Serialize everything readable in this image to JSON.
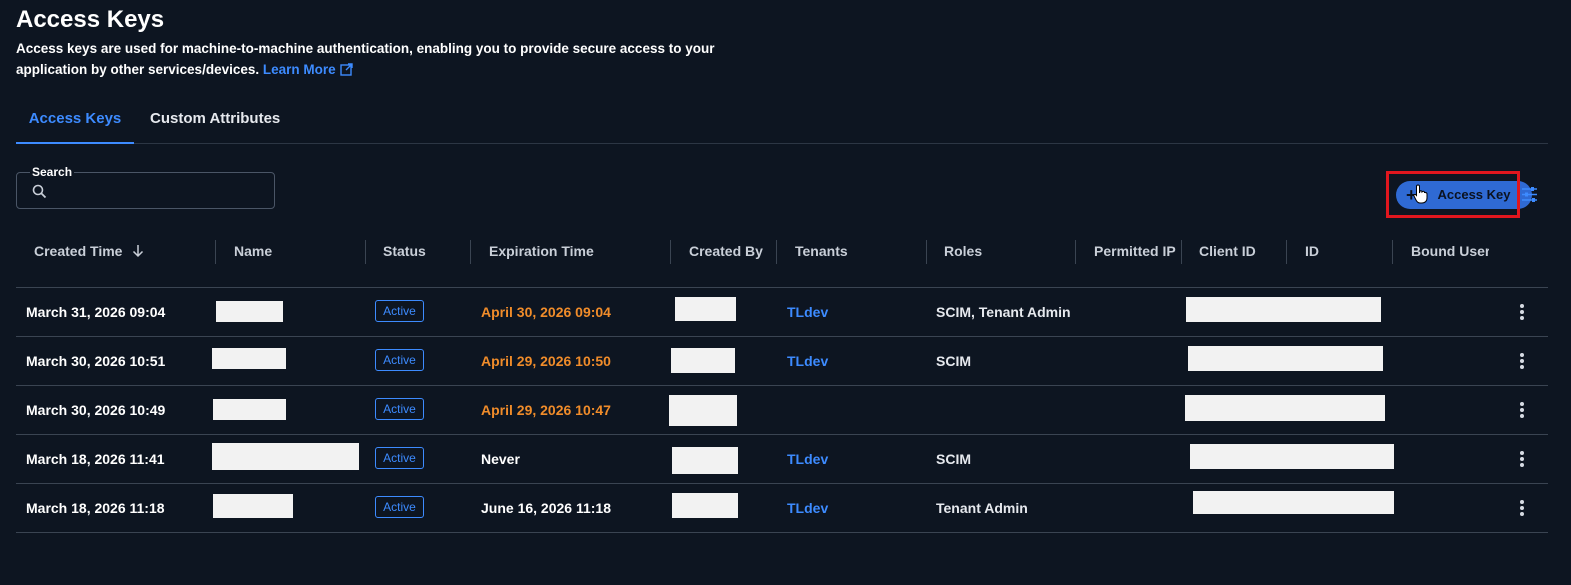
{
  "page": {
    "title": "Access Keys",
    "description": "Access keys are used for machine-to-machine authentication, enabling you to provide secure access to your application by other services/devices.",
    "learn_more": "Learn More"
  },
  "tabs": [
    {
      "label": "Access Keys",
      "active": true
    },
    {
      "label": "Custom Attributes",
      "active": false
    }
  ],
  "search": {
    "label": "Search",
    "value": "",
    "placeholder": ""
  },
  "toolbar": {
    "add_label": "Access Key",
    "add_icon": "plus-icon",
    "settings_icon": "table-settings-icon"
  },
  "columns": [
    "Created Time",
    "Name",
    "Status",
    "Expiration Time",
    "Created By",
    "Tenants",
    "Roles",
    "Permitted IP",
    "Client ID",
    "ID",
    "Bound User N"
  ],
  "sort": {
    "column": "Created Time",
    "direction": "desc"
  },
  "rows": [
    {
      "created": "March 31, 2026 09:04",
      "status": "Active",
      "expiration": "April 30, 2026 09:04",
      "expiration_style": "orange",
      "tenants": "TLdev",
      "roles": "SCIM, Tenant Admin"
    },
    {
      "created": "March 30, 2026 10:51",
      "status": "Active",
      "expiration": "April 29, 2026 10:50",
      "expiration_style": "orange",
      "tenants": "TLdev",
      "roles": "SCIM"
    },
    {
      "created": "March 30, 2026 10:49",
      "status": "Active",
      "expiration": "April 29, 2026 10:47",
      "expiration_style": "orange",
      "tenants": "",
      "roles": ""
    },
    {
      "created": "March 18, 2026 11:41",
      "status": "Active",
      "expiration": "Never",
      "expiration_style": "white",
      "tenants": "TLdev",
      "roles": "SCIM"
    },
    {
      "created": "March 18, 2026 11:18",
      "status": "Active",
      "expiration": "June 16, 2026 11:18",
      "expiration_style": "white",
      "tenants": "TLdev",
      "roles": "Tenant Admin"
    }
  ],
  "colors": {
    "background": "#0d1521",
    "accent": "#3d8bff",
    "warning": "#f08c2a",
    "highlight": "#e0161e",
    "button": "#2f6ad4"
  }
}
